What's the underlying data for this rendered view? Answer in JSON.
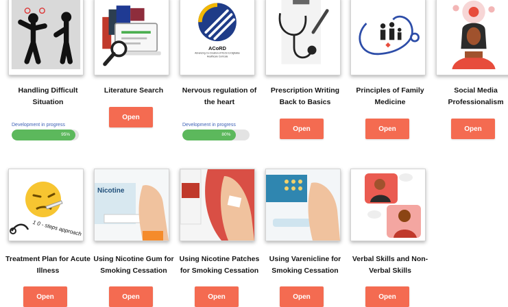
{
  "courses": [
    {
      "title": "Handling Difficult Situation",
      "progress_label": "Development in progress",
      "progress_value": 95,
      "progress_text": "95%"
    },
    {
      "title": "Literature Search",
      "open_label": "Open"
    },
    {
      "title": "Nervous regulation of the heart",
      "logo_text": "ACoRD",
      "logo_subtext": "Advancing Co-Creation of RLOs to Digitalise Healthcare Curricula",
      "progress_label": "Development in progress",
      "progress_value": 80,
      "progress_text": "80%"
    },
    {
      "title": "Prescription Writing Back to Basics",
      "open_label": "Open"
    },
    {
      "title": "Principles of Family Medicine",
      "open_label": "Open"
    },
    {
      "title": "Social Media Professionalism",
      "open_label": "Open"
    },
    {
      "title": "Treatment Plan for Acute Illness",
      "image_text": "1 0 - steps approach",
      "open_label": "Open"
    },
    {
      "title": "Using Nicotine Gum for Smoking Cessation",
      "image_text": "Nicotine",
      "open_label": "Open"
    },
    {
      "title": "Using Nicotine Patches for Smoking Cessation",
      "open_label": "Open"
    },
    {
      "title": "Using Varenicline for Smoking Cessation",
      "open_label": "Open"
    },
    {
      "title": "Verbal Skills and Non-Verbal Skills",
      "open_label": "Open"
    }
  ],
  "colors": {
    "button": "#f46b51",
    "progress": "#5cb85c",
    "progress_track": "#e3e3e3",
    "progress_label": "#3b5fb5"
  },
  "icons": [
    "people-arguing-icon",
    "laptop-magnifier-icon",
    "acord-logo-icon",
    "stethoscope-icon",
    "family-stethoscope-icon",
    "woman-thinking-icon",
    "sick-face-icon",
    "nicotine-gum-icon",
    "nicotine-patch-icon",
    "varenicline-icon",
    "video-chat-icon"
  ]
}
